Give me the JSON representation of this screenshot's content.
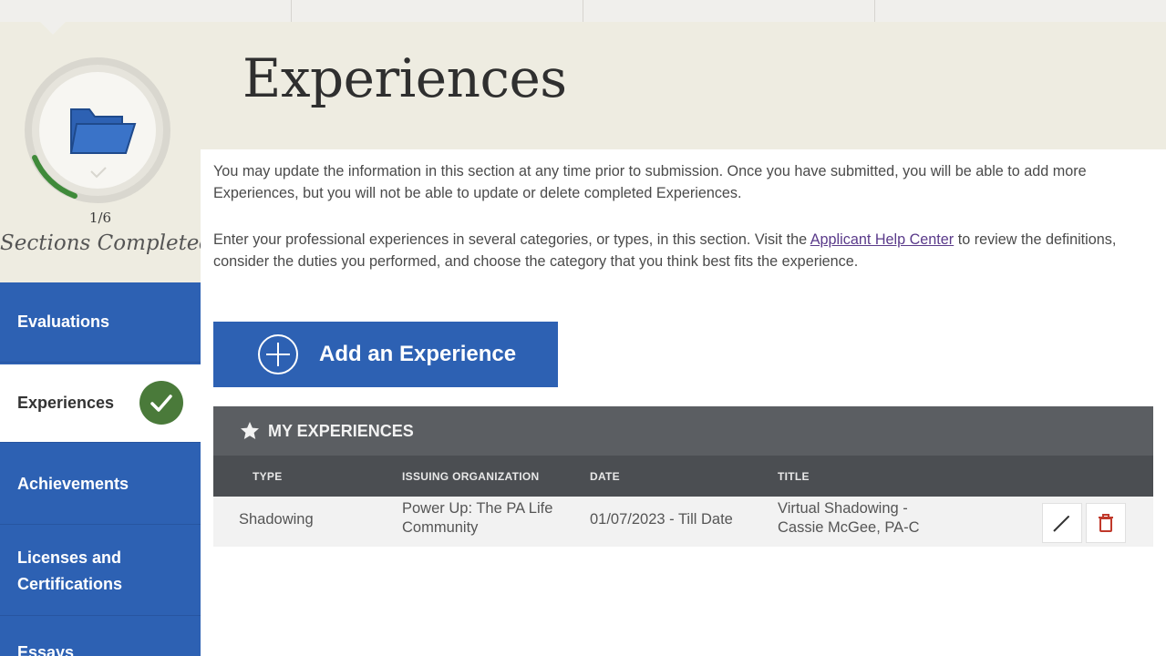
{
  "page": {
    "title": "Experiences"
  },
  "progress": {
    "count": "1/6",
    "label": "Sections Completed",
    "fraction": 0.1667
  },
  "sidebar": {
    "items": [
      {
        "label": "Evaluations",
        "active": false
      },
      {
        "label": "Experiences",
        "active": true,
        "completed": true
      },
      {
        "label": "Achievements",
        "active": false
      },
      {
        "label_line1": "Licenses and",
        "label_line2": "Certifications",
        "active": false
      },
      {
        "label": "Essays",
        "active": false
      }
    ]
  },
  "intro": {
    "para1": "You may update the information in this section at any time prior to submission. Once you have submitted, you will be able to add more Experiences, but you will not be able to update or delete completed Experiences.",
    "para2_before": "Enter your professional experiences in several categories, or types, in this section. Visit the ",
    "para2_link": "Applicant Help Center",
    "para2_after": " to review the definitions, consider the duties you performed, and choose the category that you think best fits the experience."
  },
  "actions": {
    "add_label": "Add an Experience"
  },
  "table": {
    "title": "MY EXPERIENCES",
    "columns": [
      "TYPE",
      "ISSUING ORGANIZATION",
      "DATE",
      "TITLE"
    ],
    "rows": [
      {
        "type": "Shadowing",
        "org_line1": "Power Up: The PA Life",
        "org_line2": "Community",
        "date": "01/07/2023 - Till Date",
        "title_line1": "Virtual Shadowing -",
        "title_line2": "Cassie McGee, PA-C"
      }
    ]
  },
  "colors": {
    "accent": "#2d61b3",
    "success": "#4a7a3a",
    "header_bg": "#eeece1",
    "table_header": "#5b5e62"
  },
  "icons": [
    "folder-icon",
    "check-icon",
    "plus-icon",
    "star-icon",
    "pencil-icon",
    "trash-icon"
  ]
}
